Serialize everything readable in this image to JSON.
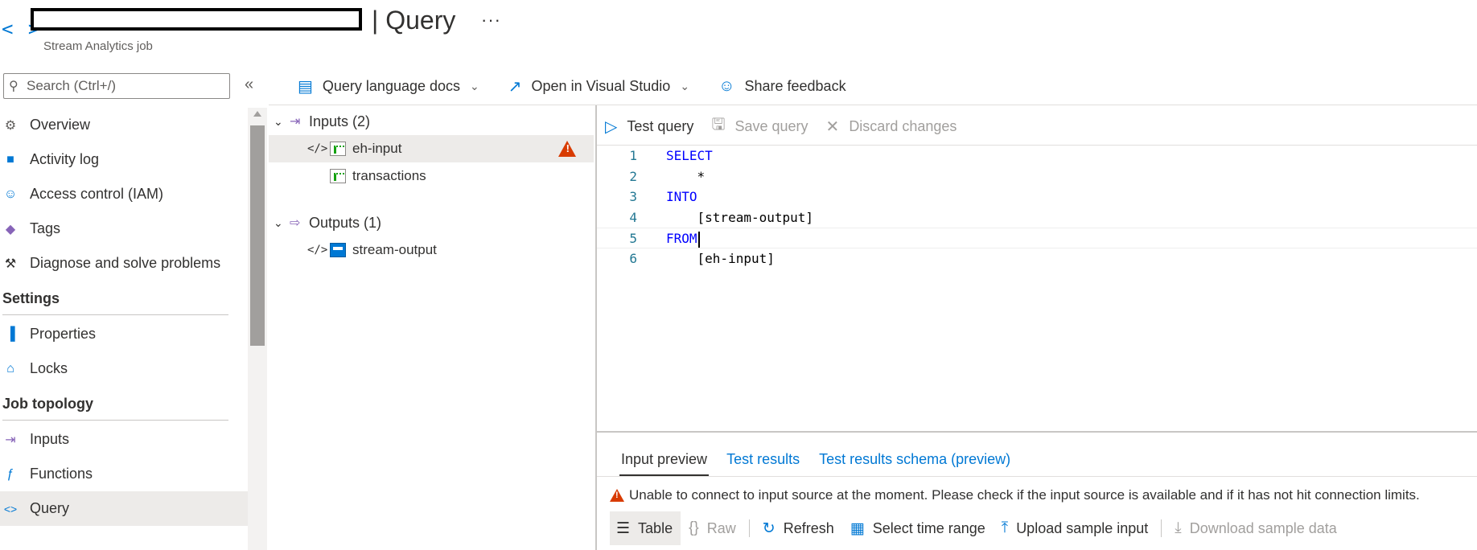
{
  "header": {
    "title": "| Query",
    "subtitle": "Stream Analytics job",
    "more_label": "···",
    "brand_icon_glyph": "< >"
  },
  "sidebar": {
    "search_placeholder": "Search (Ctrl+/)",
    "collapse_glyph": "«",
    "items_top": [
      {
        "label": "Overview",
        "icon": "gear-icon",
        "glyph": "⚙",
        "color": "#605e5c"
      },
      {
        "label": "Activity log",
        "icon": "log-icon",
        "glyph": "■",
        "color": "#0078d4"
      },
      {
        "label": "Access control (IAM)",
        "icon": "people-icon",
        "glyph": "☺",
        "color": "#0078d4"
      },
      {
        "label": "Tags",
        "icon": "tag-icon",
        "glyph": "◆",
        "color": "#8764b8"
      },
      {
        "label": "Diagnose and solve problems",
        "icon": "wrench-icon",
        "glyph": "⚒",
        "color": "#323130"
      }
    ],
    "section_settings": "Settings",
    "items_settings": [
      {
        "label": "Properties",
        "icon": "properties-icon",
        "glyph": "▐",
        "color": "#0078d4"
      },
      {
        "label": "Locks",
        "icon": "lock-icon",
        "glyph": "⌂",
        "color": "#0078d4"
      }
    ],
    "section_topology": "Job topology",
    "items_topology": [
      {
        "label": "Inputs",
        "icon": "inputs-icon",
        "glyph": "⇥",
        "color": "#8764b8"
      },
      {
        "label": "Functions",
        "icon": "functions-icon",
        "glyph": "ƒ",
        "color": "#0078d4"
      },
      {
        "label": "Query",
        "icon": "query-icon",
        "glyph": "<>",
        "color": "#0078d4"
      }
    ]
  },
  "command_bar": {
    "docs_label": "Query language docs",
    "open_vs_label": "Open in Visual Studio",
    "feedback_label": "Share feedback"
  },
  "tree": {
    "inputs_label": "Inputs (2)",
    "inputs": [
      "eh-input",
      "transactions"
    ],
    "outputs_label": "Outputs (1)",
    "outputs": [
      "stream-output"
    ],
    "code_glyph": "</>"
  },
  "editor_toolbar": {
    "test_label": "Test query",
    "save_label": "Save query",
    "discard_label": "Discard changes"
  },
  "code": {
    "line_numbers": [
      "1",
      "2",
      "3",
      "4",
      "5",
      "6"
    ],
    "line1": "SELECT",
    "line2": "    *",
    "line3": "INTO",
    "line4": "    [stream-output]",
    "line5": "FROM",
    "line6": "    [eh-input]"
  },
  "results": {
    "tabs": [
      "Input preview",
      "Test results",
      "Test results schema (preview)"
    ],
    "warning": "Unable to connect to input source at the moment. Please check if the input source is available and if it has not hit connection limits.",
    "toolbar": {
      "table_label": "Table",
      "raw_label": "Raw",
      "refresh_label": "Refresh",
      "time_range_label": "Select time range",
      "upload_label": "Upload sample input",
      "download_label": "Download sample data"
    }
  },
  "colors": {
    "accent": "#0078d4",
    "warning": "#d83b01",
    "selected_bg": "#edebe9",
    "keyword": "#0000ff"
  }
}
